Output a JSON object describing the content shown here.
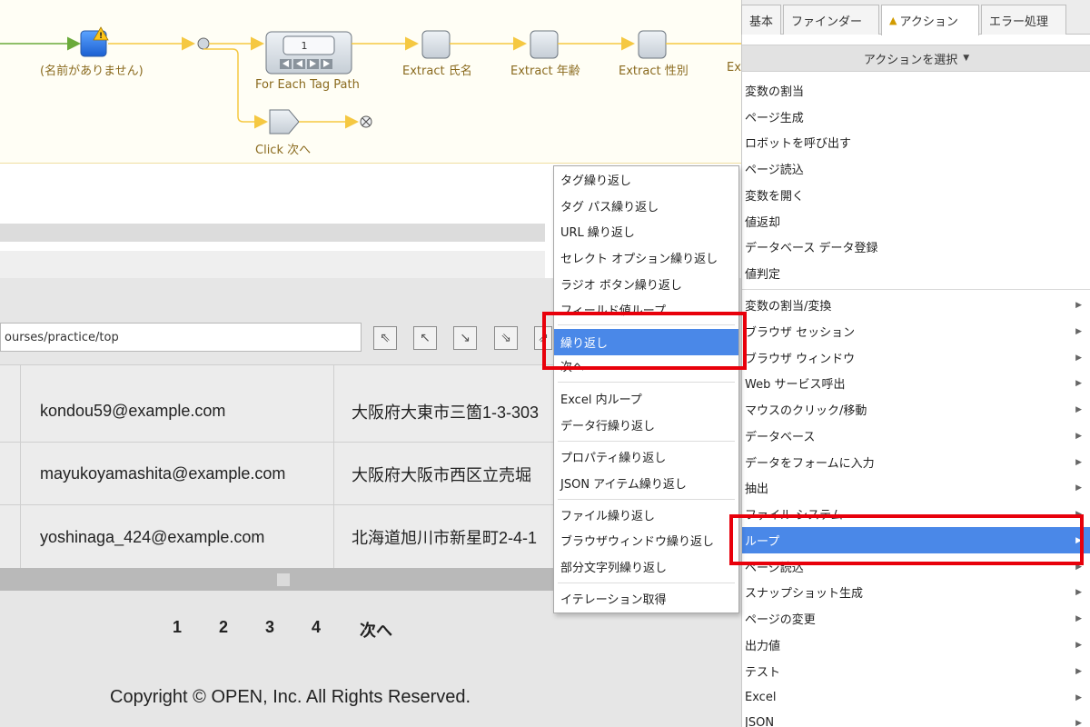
{
  "flow": {
    "nodes": {
      "unnamed": "(名前がありません)",
      "for_each_tag_path": "For Each Tag Path",
      "counter": "1",
      "extract_name": "Extract 氏名",
      "extract_age": "Extract 年齢",
      "extract_gender": "Extract 性別",
      "extract_cut": "Ex",
      "click_next": "Click 次へ"
    }
  },
  "browser": {
    "url": "ourses/practice/top",
    "nav_buttons": [
      "nav-top-left-icon",
      "nav-up-left-icon",
      "nav-down-right-icon",
      "nav-down-right-alt-icon"
    ],
    "table": {
      "rows": [
        {
          "email": "kondou59@example.com",
          "address": "大阪府大東市三箇1-3-303"
        },
        {
          "email": "mayukoyamashita@example.com",
          "address": "大阪府大阪市西区立売堀"
        },
        {
          "email": "yoshinaga_424@example.com",
          "address": "北海道旭川市新星町2-4-1"
        }
      ]
    },
    "pager": [
      "1",
      "2",
      "3",
      "4",
      "次へ"
    ],
    "copyright": "Copyright © OPEN, Inc. All Rights Reserved."
  },
  "side_panel": {
    "tabs": [
      {
        "label": "基本",
        "active": false
      },
      {
        "label": "ファインダー",
        "active": false
      },
      {
        "label": "アクション",
        "active": true,
        "icon": "warning-icon"
      },
      {
        "label": "エラー処理",
        "active": false
      }
    ],
    "select_label": "アクションを選択",
    "plain_items": [
      "変数の割当",
      "ページ生成",
      "ロボットを呼び出す",
      "ページ読込",
      "変数を開く",
      "値返却",
      "データベース データ登録",
      "値判定"
    ],
    "category_items": [
      "変数の割当/変換",
      "ブラウザ セッション",
      "ブラウザ ウィンドウ",
      "Web サービス呼出",
      "マウスのクリック/移動",
      "データベース",
      "データをフォームに入力",
      "抽出",
      "ファイル システム",
      "ループ",
      "ページ読込",
      "スナップショット生成",
      "ページの変更",
      "出力値",
      "テスト",
      "Excel",
      "JSON"
    ],
    "highlighted_item": "ループ"
  },
  "submenu": {
    "groups": [
      [
        "タグ繰り返し",
        "タグ パス繰り返し",
        "URL 繰り返し",
        "セレクト オプション繰り返し",
        "ラジオ ボタン繰り返し",
        "フィールド値ループ"
      ],
      [
        "繰り返し",
        "次へ"
      ],
      [
        "Excel 内ループ",
        "データ行繰り返し"
      ],
      [
        "プロパティ繰り返し",
        "JSON アイテム繰り返し"
      ],
      [
        "ファイル繰り返し",
        "ブラウザウィンドウ繰り返し",
        "部分文字列繰り返し"
      ],
      [
        "イテレーション取得"
      ]
    ],
    "highlighted_item": "繰り返し"
  },
  "colors": {
    "highlight": "#4a88e8",
    "callout": "#e8000b",
    "flow_line": "#f5c842",
    "flow_line_green": "#6aaa3a"
  }
}
